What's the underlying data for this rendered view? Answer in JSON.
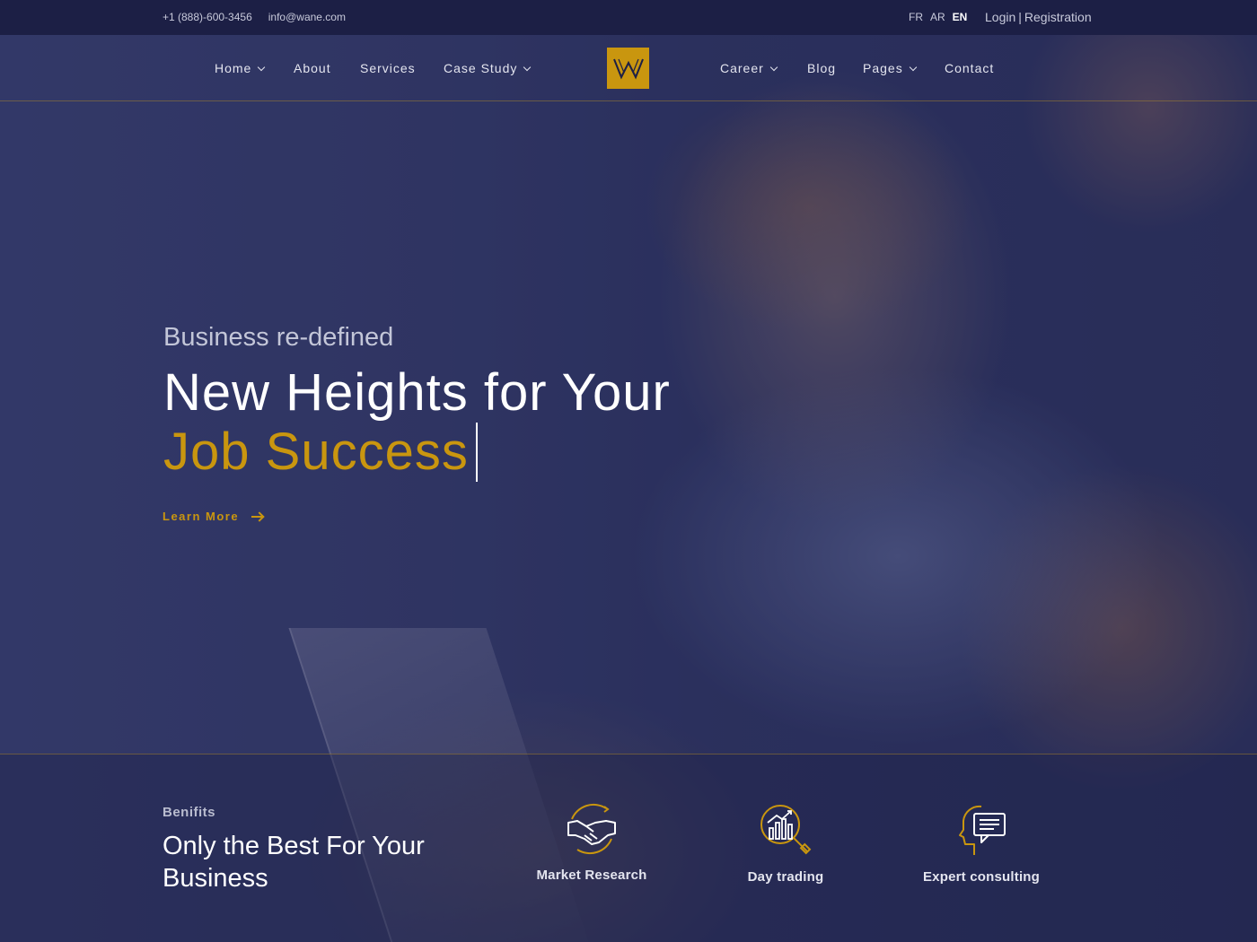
{
  "topbar": {
    "phone": "+1 (888)-600-3456",
    "email": "info@wane.com",
    "languages": [
      {
        "code": "FR",
        "active": false
      },
      {
        "code": "AR",
        "active": false
      },
      {
        "code": "EN",
        "active": true
      }
    ],
    "login": "Login",
    "separator": "|",
    "registration": "Registration"
  },
  "nav": {
    "left": [
      {
        "label": "Home",
        "dropdown": true
      },
      {
        "label": "About",
        "dropdown": false
      },
      {
        "label": "Services",
        "dropdown": false
      },
      {
        "label": "Case Study",
        "dropdown": true
      }
    ],
    "right": [
      {
        "label": "Career",
        "dropdown": true
      },
      {
        "label": "Blog",
        "dropdown": false
      },
      {
        "label": "Pages",
        "dropdown": true
      },
      {
        "label": "Contact",
        "dropdown": false
      }
    ],
    "logo_icon": "w-logo-icon"
  },
  "hero": {
    "kicker": "Business re-defined",
    "headline_line1": "New Heights for Your",
    "headline_line2": "Job Success",
    "cta": "Learn More"
  },
  "benefits": {
    "label": "Benifits",
    "title": "Only the Best For Your Business",
    "features": [
      {
        "label": "Market Research",
        "icon": "handshake-icon"
      },
      {
        "label": "Day trading",
        "icon": "chart-magnifier-icon"
      },
      {
        "label": "Expert consulting",
        "icon": "head-chat-icon"
      }
    ]
  },
  "colors": {
    "accent": "#c9960f",
    "topbar_bg": "#1c1f45",
    "overlay": "#262a58"
  }
}
